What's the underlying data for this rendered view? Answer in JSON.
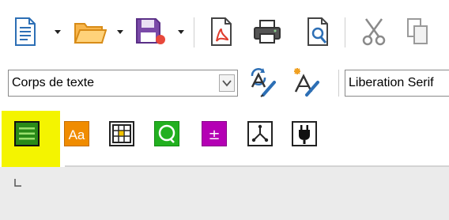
{
  "toolbar": {
    "buttons": [
      {
        "id": "new",
        "icon": "new-document-icon"
      },
      {
        "id": "open",
        "icon": "open-folder-icon"
      },
      {
        "id": "save",
        "icon": "save-icon"
      },
      {
        "id": "export-pdf",
        "icon": "export-pdf-icon"
      },
      {
        "id": "print",
        "icon": "printer-icon"
      },
      {
        "id": "print-preview",
        "icon": "print-preview-icon"
      },
      {
        "id": "cut",
        "icon": "scissors-icon"
      },
      {
        "id": "copy",
        "icon": "copy-icon"
      }
    ]
  },
  "formatting": {
    "paragraph_style": "Corps de texte",
    "font_name": "Liberation Serif"
  },
  "sidebar_deck": {
    "buttons": [
      {
        "id": "properties",
        "icon": "properties-icon",
        "color": "#2a8a18",
        "highlighted": true
      },
      {
        "id": "styles",
        "icon": "styles-icon",
        "color": "#f08c00",
        "label": "Aa"
      },
      {
        "id": "gallery",
        "icon": "gallery-icon",
        "color": "#ffffff"
      },
      {
        "id": "navigator",
        "icon": "navigator-icon",
        "color": "#22b020"
      },
      {
        "id": "manage-changes",
        "icon": "manage-changes-icon",
        "color": "#b400b4",
        "label": "±"
      },
      {
        "id": "design",
        "icon": "design-icon",
        "color": "#ffffff"
      },
      {
        "id": "extension",
        "icon": "plug-icon",
        "color": "#ffffff"
      }
    ],
    "highlight_color": "#f4f400"
  }
}
